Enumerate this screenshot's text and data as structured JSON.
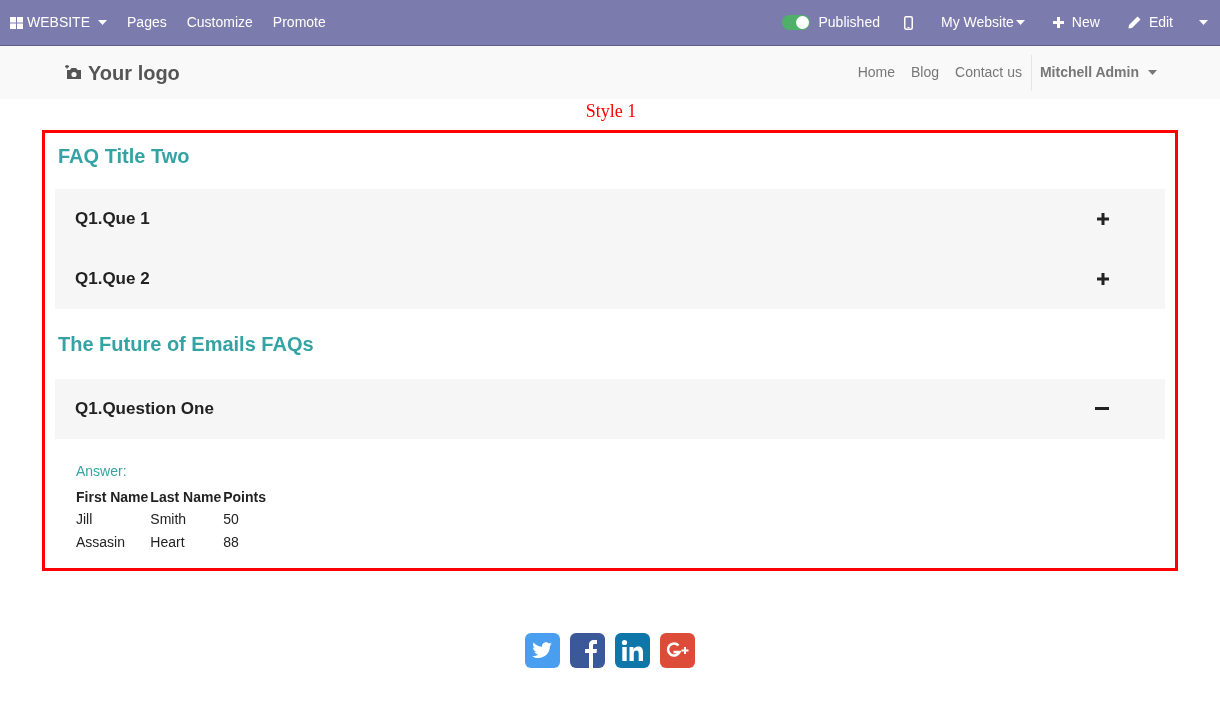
{
  "top_bar": {
    "app_menu": "WEBSITE",
    "items": [
      "Pages",
      "Customize",
      "Promote"
    ],
    "published": {
      "label": "Published",
      "on": true
    },
    "website_menu": "My Website",
    "new_button": "New",
    "edit_button": "Edit"
  },
  "header": {
    "logo": "Your logo",
    "nav": [
      "Home",
      "Blog",
      "Contact us"
    ],
    "user": "Mitchell Admin"
  },
  "style_label": "Style 1",
  "faq_groups": [
    {
      "title": "FAQ Title Two",
      "questions": [
        {
          "question": "Q1.Que 1",
          "expanded": false
        },
        {
          "question": "Q1.Que 2",
          "expanded": false
        }
      ]
    },
    {
      "title": "The Future of Emails FAQs",
      "questions": [
        {
          "question": "Q1.Question One",
          "expanded": true,
          "answer_label": "Answer:",
          "table": {
            "columns": [
              "First Name",
              "Last Name",
              "Points"
            ],
            "rows": [
              [
                "Jill",
                "Smith",
                "50"
              ],
              [
                "Assasin",
                "Heart",
                "88"
              ]
            ]
          }
        }
      ]
    }
  ],
  "social": [
    {
      "kind": "twitter"
    },
    {
      "kind": "facebook"
    },
    {
      "kind": "linkedin"
    },
    {
      "kind": "googleplus"
    }
  ]
}
